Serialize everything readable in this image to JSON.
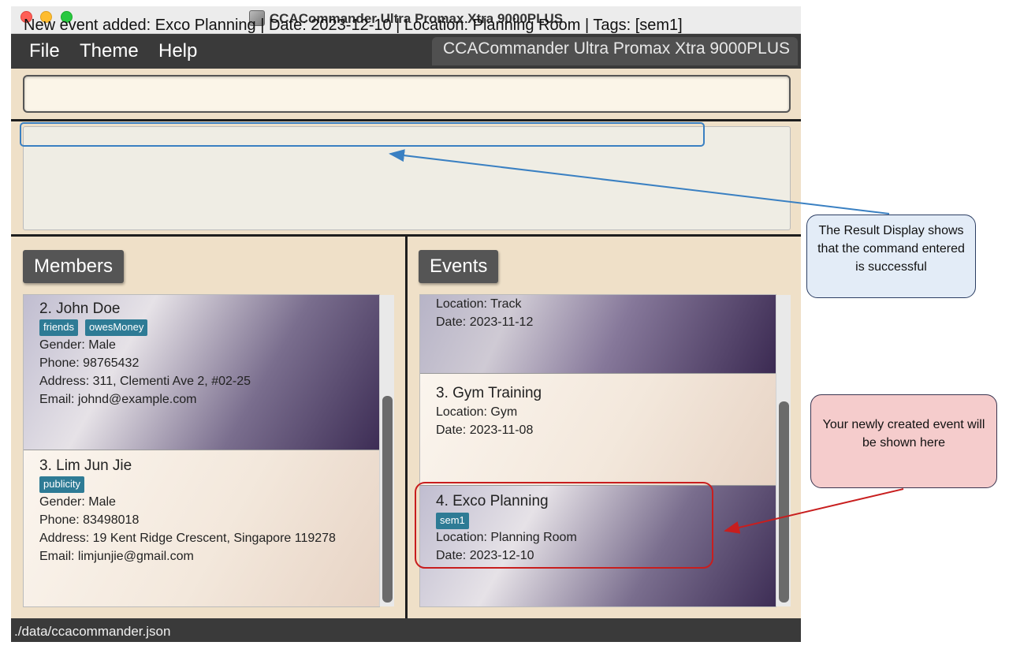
{
  "window": {
    "title": "CCACommander Ultra Promax Xtra 9000PLUS"
  },
  "menu": {
    "items": [
      "File",
      "Theme",
      "Help"
    ],
    "app_name": "CCACommander Ultra Promax Xtra 9000PLUS"
  },
  "command_box": {
    "value": ""
  },
  "result_display": {
    "text": "New event added: Exco Planning | Date: 2023-12-10 | Location: Planning Room | Tags: [sem1]"
  },
  "members_panel": {
    "title": "Members",
    "cards": [
      {
        "title": "2.  John Doe",
        "tags": [
          "friends",
          "owesMoney"
        ],
        "gender": "Gender: Male",
        "phone": "Phone: 98765432",
        "address": "Address: 311, Clementi Ave 2, #02-25",
        "email": "Email: johnd@example.com"
      },
      {
        "title": "3.  Lim Jun Jie",
        "tags": [
          "publicity"
        ],
        "gender": "Gender: Male",
        "phone": "Phone: 83498018",
        "address": "Address: 19 Kent Ridge Crescent, Singapore 119278",
        "email": "Email: limjunjie@gmail.com"
      }
    ]
  },
  "events_panel": {
    "title": "Events",
    "cards": [
      {
        "location": "Location: Track",
        "date": "Date: 2023-11-12"
      },
      {
        "title": "3.  Gym Training",
        "location": "Location: Gym",
        "date": "Date: 2023-11-08"
      },
      {
        "title": "4.  Exco Planning",
        "tags": [
          "sem1"
        ],
        "location": "Location: Planning Room",
        "date": "Date: 2023-12-10"
      }
    ]
  },
  "status_bar": {
    "path": "./data/ccacommander.json"
  },
  "annotations": {
    "result_callout": "The Result Display shows that the command entered is successful",
    "event_callout": "Your newly created event will be shown here"
  },
  "colors": {
    "window_bg": "#efe0c8",
    "menubar_bg": "#3a3a3a",
    "tag_bg": "#2e7b95",
    "result_highlight": "#3a80c2",
    "event_highlight": "#c81e1e",
    "callout_blue_bg": "#e3ecf7",
    "callout_red_bg": "#f5cccc"
  }
}
